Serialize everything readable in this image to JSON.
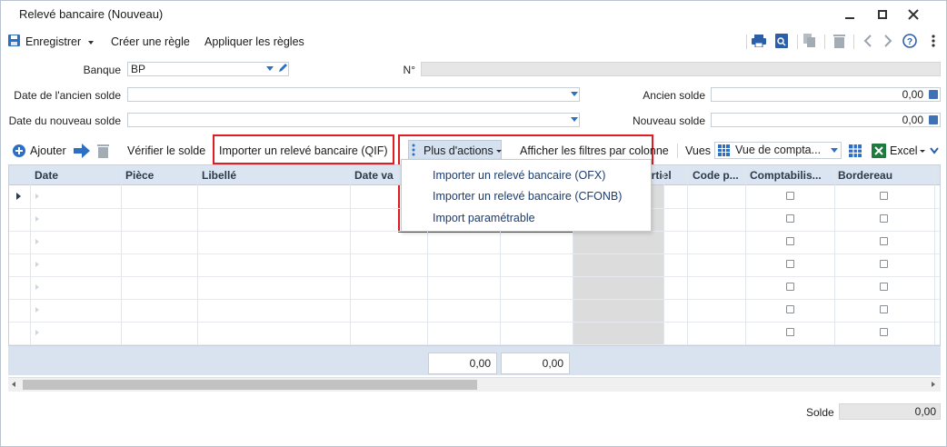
{
  "window": {
    "title": "Relevé bancaire (Nouveau)"
  },
  "toolbar": {
    "save_label": "Enregistrer",
    "create_rule_label": "Créer une règle",
    "apply_rules_label": "Appliquer les règles",
    "icons": [
      "print-icon",
      "print-preview-icon",
      "copy-icon",
      "delete-icon",
      "previous-icon",
      "next-icon",
      "help-icon",
      "more-vertical-icon"
    ]
  },
  "form": {
    "banque_label": "Banque",
    "banque_value": "BP",
    "numero_label": "N°",
    "numero_value": "",
    "ancien_date_label": "Date de l'ancien solde",
    "ancien_date_value": "",
    "nouveau_date_label": "Date du nouveau solde",
    "nouveau_date_value": "",
    "ancien_solde_label": "Ancien solde",
    "ancien_solde_value": "0,00",
    "nouveau_solde_label": "Nouveau solde",
    "nouveau_solde_value": "0,00"
  },
  "grid_toolbar": {
    "add_label": "Ajouter",
    "verify_label": "Vérifier le solde",
    "import_qif_label": "Importer un relevé bancaire (QIF)",
    "more_actions_label": "Plus d'actions",
    "filters_label": "Afficher les filtres par colonne",
    "views_label": "Vues",
    "view_value": "Vue de compta...",
    "excel_label": "Excel"
  },
  "menu": {
    "items": [
      "Importer un relevé bancaire (OFX)",
      "Importer un relevé bancaire (CFONB)",
      "Import paramétrable"
    ]
  },
  "grid": {
    "columns": [
      "Date",
      "Pièce",
      "Libellé",
      "Date va",
      "artiel",
      "Code p...",
      "Comptabilis...",
      "Bordereau"
    ],
    "rows": 7
  },
  "totals": {
    "total1": "0,00",
    "total2": "0,00"
  },
  "footer": {
    "solde_label": "Solde",
    "solde_value": "0,00"
  },
  "colors": {
    "accent": "#2d6fc4",
    "highlight": "#e01c24",
    "header_bg": "#dbe5f1"
  }
}
